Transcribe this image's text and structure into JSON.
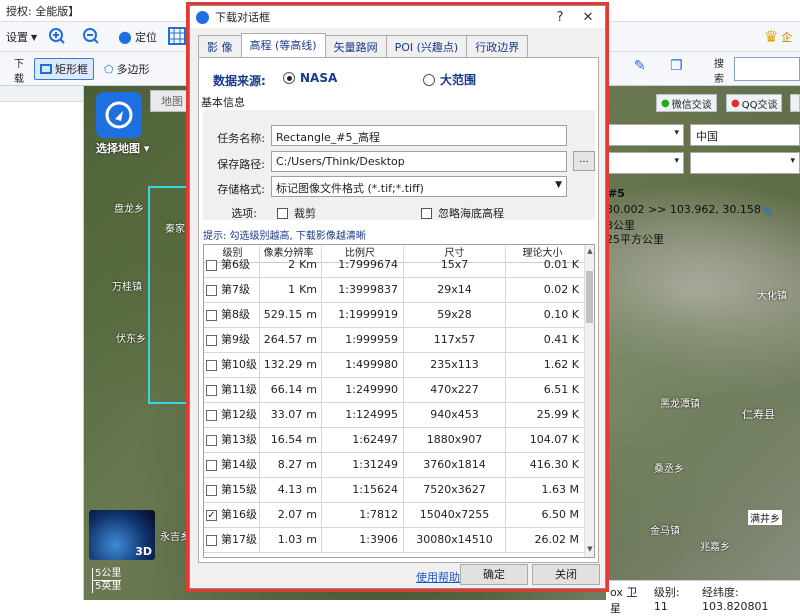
{
  "app": {
    "title_fragment": "授权: 全能版】",
    "toolbar": {
      "settings": "设置",
      "locate": "定位",
      "rect": "矩形框",
      "polygon": "多边形",
      "download_lines": [
        "下",
        "载"
      ],
      "search_lines": [
        "搜",
        "索"
      ]
    },
    "map": {
      "tab": "地图",
      "select_map": "选择地图",
      "places": [
        "盘龙乡",
        "秦家",
        "万桂镇",
        "伏东乡",
        "永吉乡"
      ],
      "scale": [
        "5公里",
        "5英里"
      ],
      "globe_badge": "3D"
    },
    "right_panel": {
      "wechat": "微信交谈",
      "qq": "QQ交谈",
      "country": "中国",
      "info_title": "#5",
      "info_coords": "30.002 >> 103.962, 30.158",
      "info_unit1": "3公里",
      "info_unit2": "25平方公里",
      "places": [
        "大化镇",
        "黑龙潭镇",
        "仁寿县",
        "桑丞乡",
        "金马镇",
        "兆嘉乡",
        "满井乡"
      ]
    },
    "status": {
      "source": "ox 卫星",
      "level": "级别: 11",
      "coords": "经纬度: 103.820801"
    }
  },
  "dialog": {
    "title": "下载对话框",
    "help_glyph": "?",
    "close_glyph": "✕",
    "tabs": [
      "影 像",
      "高程 (等高线)",
      "矢量路网",
      "POI (兴趣点)",
      "行政边界"
    ],
    "active_tab": 1,
    "source_label": "数据来源:",
    "sources": [
      {
        "label": "NASA",
        "selected": true
      },
      {
        "label": "大范围",
        "selected": false
      }
    ],
    "group_title": "基本信息",
    "task_label": "任务名称:",
    "task_value": "Rectangle_#5_高程",
    "path_label": "保存路径:",
    "path_value": "C:/Users/Think/Desktop",
    "browse_label": "...",
    "format_label": "存储格式:",
    "format_value": "标记图像文件格式 (*.tif;*.tiff)",
    "options_label": "选项:",
    "option_crop": "裁剪",
    "option_ignore_sea": "忽略海底高程",
    "tip": "提示: 勾选级别越高, 下载影像越清晰",
    "table": {
      "headers": [
        "级别",
        "像素分辨率",
        "比例尺",
        "尺寸",
        "理论大小"
      ],
      "rows": [
        {
          "level": "第6级",
          "res": "2",
          "unit": "Km",
          "scale": "1:7999674",
          "size": "15x7",
          "est": "0.01 K",
          "checked": false
        },
        {
          "level": "第7级",
          "res": "1",
          "unit": "Km",
          "scale": "1:3999837",
          "size": "29x14",
          "est": "0.02 K",
          "checked": false
        },
        {
          "level": "第8级",
          "res": "529.15",
          "unit": "m",
          "scale": "1:1999919",
          "size": "59x28",
          "est": "0.10 K",
          "checked": false
        },
        {
          "level": "第9级",
          "res": "264.57",
          "unit": "m",
          "scale": "1:999959",
          "size": "117x57",
          "est": "0.41 K",
          "checked": false
        },
        {
          "level": "第10级",
          "res": "132.29",
          "unit": "m",
          "scale": "1:499980",
          "size": "235x113",
          "est": "1.62 K",
          "checked": false
        },
        {
          "level": "第11级",
          "res": "66.14",
          "unit": "m",
          "scale": "1:249990",
          "size": "470x227",
          "est": "6.51 K",
          "checked": false
        },
        {
          "level": "第12级",
          "res": "33.07",
          "unit": "m",
          "scale": "1:124995",
          "size": "940x453",
          "est": "25.99 K",
          "checked": false
        },
        {
          "level": "第13级",
          "res": "16.54",
          "unit": "m",
          "scale": "1:62497",
          "size": "1880x907",
          "est": "104.07 K",
          "checked": false
        },
        {
          "level": "第14级",
          "res": "8.27",
          "unit": "m",
          "scale": "1:31249",
          "size": "3760x1814",
          "est": "416.30 K",
          "checked": false
        },
        {
          "level": "第15级",
          "res": "4.13",
          "unit": "m",
          "scale": "1:15624",
          "size": "7520x3627",
          "est": "1.63 M",
          "checked": false
        },
        {
          "level": "第16级",
          "res": "2.07",
          "unit": "m",
          "scale": "1:7812",
          "size": "15040x7255",
          "est": "6.50 M",
          "checked": true
        },
        {
          "level": "第17级",
          "res": "1.03",
          "unit": "m",
          "scale": "1:3906",
          "size": "30080x14510",
          "est": "26.02 M",
          "checked": false
        }
      ]
    },
    "help_link": "使用帮助",
    "ok": "确定",
    "close": "关闭"
  }
}
